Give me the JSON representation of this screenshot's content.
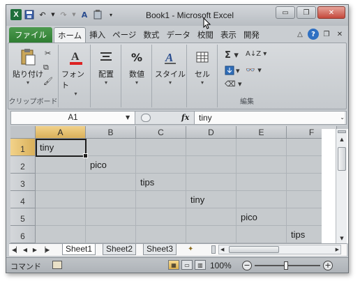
{
  "window": {
    "title": "Book1 - Microsoft Excel",
    "controls": {
      "minimize": "▭",
      "restore": "❐",
      "close": "✕"
    }
  },
  "quick_access": {
    "icons": [
      "excel-logo",
      "save-icon",
      "undo-icon",
      "redo-icon",
      "spelling-icon",
      "customize-icon"
    ],
    "excel_letter": "X"
  },
  "ribbon_tabs": [
    "ファイル",
    "ホーム",
    "挿入",
    "ページ",
    "数式",
    "データ",
    "校閲",
    "表示",
    "開発"
  ],
  "ribbon": {
    "clipboard": {
      "paste_label": "貼り付け",
      "group_label": "クリップボード"
    },
    "font": {
      "label": "フォント"
    },
    "alignment": {
      "label": "配置"
    },
    "number": {
      "label": "数値"
    },
    "styles": {
      "label": "スタイル"
    },
    "cells": {
      "label": "セル"
    },
    "editing": {
      "group_label": "編集"
    }
  },
  "formula_bar": {
    "name_box": "A1",
    "fx_label": "fx",
    "formula": "tiny"
  },
  "columns": [
    "A",
    "B",
    "C",
    "D",
    "E",
    "F"
  ],
  "rows": [
    "1",
    "2",
    "3",
    "4",
    "5",
    "6"
  ],
  "cells": [
    {
      "ref": "A1",
      "value": "tiny"
    },
    {
      "ref": "B2",
      "value": "pico"
    },
    {
      "ref": "C3",
      "value": "tips"
    },
    {
      "ref": "D4",
      "value": "tiny"
    },
    {
      "ref": "E5",
      "value": "pico"
    },
    {
      "ref": "F6",
      "value": "tips"
    }
  ],
  "active_cell": "A1",
  "sheets": [
    "Sheet1",
    "Sheet2",
    "Sheet3"
  ],
  "active_sheet": "Sheet1",
  "status_bar": {
    "mode": "コマンド",
    "zoom": "100%"
  }
}
